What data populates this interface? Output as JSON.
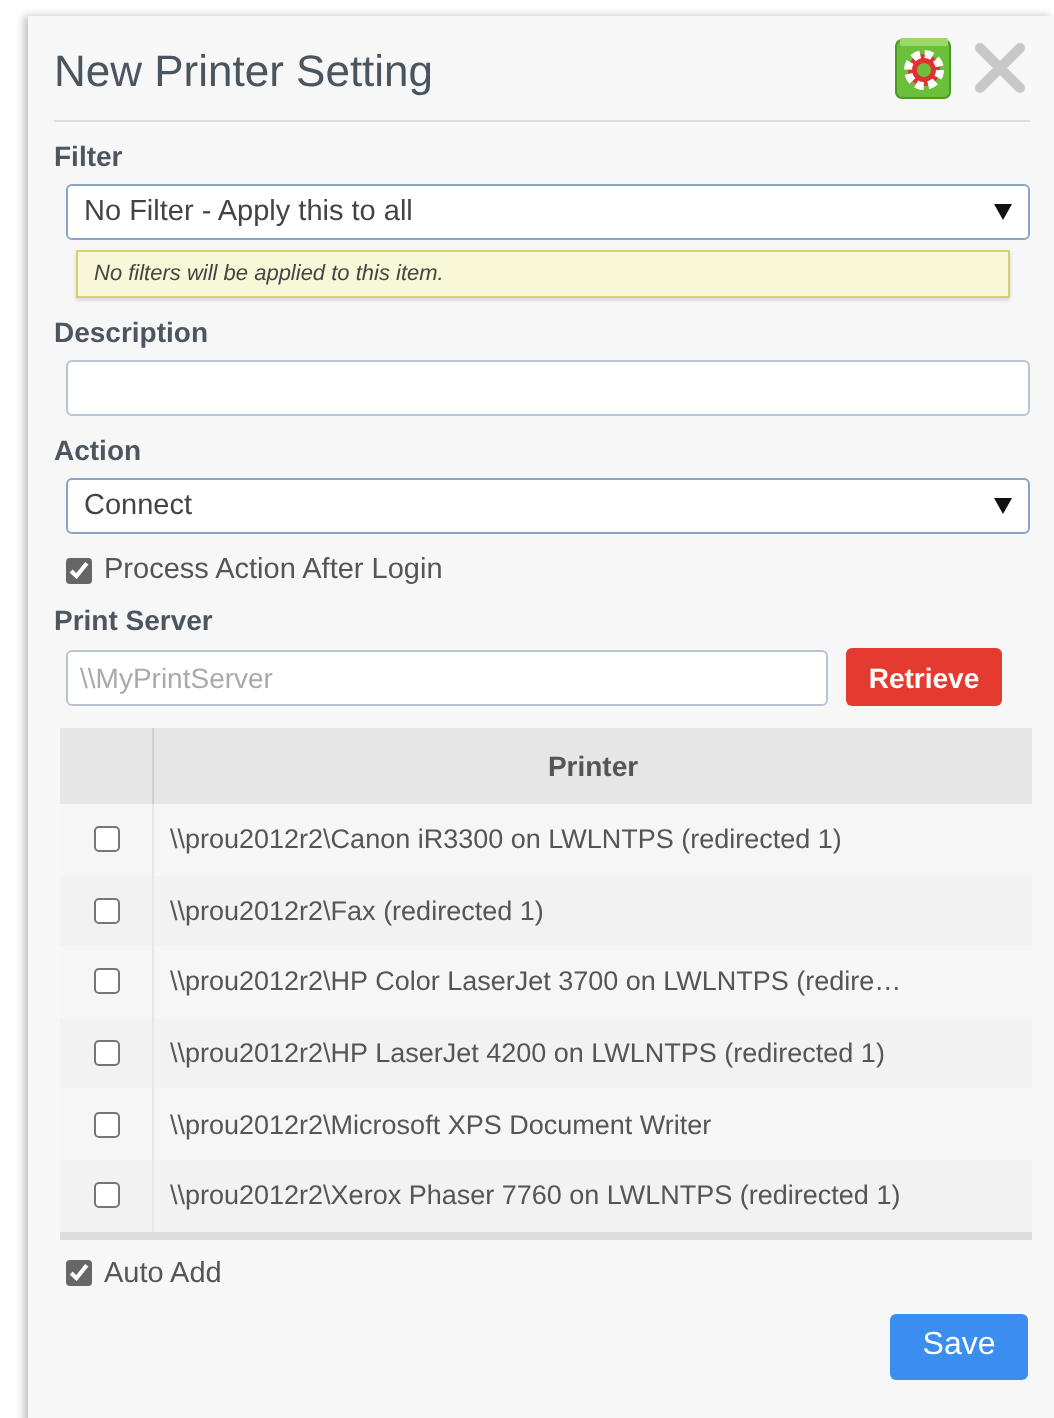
{
  "dialog": {
    "title": "New Printer Setting"
  },
  "filter": {
    "label": "Filter",
    "value": "No Filter - Apply this to all",
    "hint": "No filters will be applied to this item."
  },
  "description": {
    "label": "Description"
  },
  "action": {
    "label": "Action",
    "value": "Connect"
  },
  "process_after_login": {
    "label": "Process Action After Login",
    "checked": true
  },
  "print_server": {
    "label": "Print Server",
    "placeholder": "\\\\MyPrintServer",
    "button": "Retrieve"
  },
  "table": {
    "columns": [
      "Printer"
    ],
    "rows": [
      {
        "name": "\\\\prou2012r2\\Canon iR3300 on LWLNTPS (redirected 1)",
        "checked": false
      },
      {
        "name": "\\\\prou2012r2\\Fax (redirected 1)",
        "checked": false
      },
      {
        "name": "\\\\prou2012r2\\HP Color LaserJet 3700 on LWLNTPS (redire…",
        "checked": false
      },
      {
        "name": "\\\\prou2012r2\\HP LaserJet 4200 on LWLNTPS (redirected 1)",
        "checked": false
      },
      {
        "name": "\\\\prou2012r2\\Microsoft XPS Document Writer",
        "checked": false
      },
      {
        "name": "\\\\prou2012r2\\Xerox Phaser 7760 on LWLNTPS (redirected 1)",
        "checked": false
      }
    ]
  },
  "auto_add": {
    "label": "Auto Add",
    "checked": true
  },
  "save_button": "Save"
}
